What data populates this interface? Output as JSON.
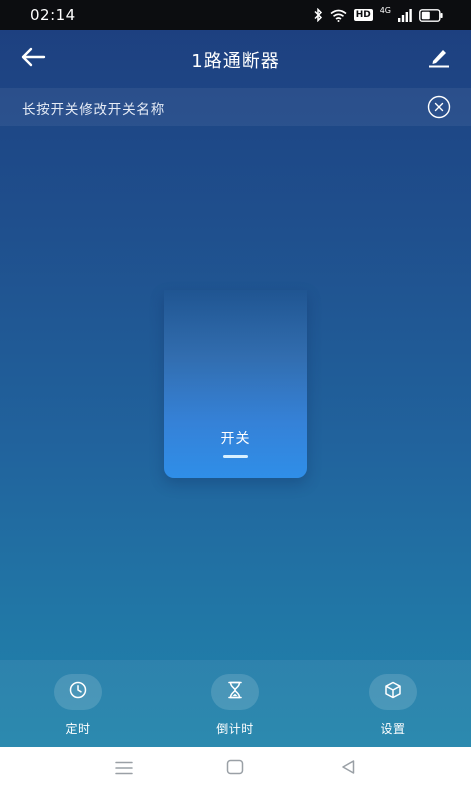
{
  "status_bar": {
    "time": "02:14",
    "hd_badge": "HD",
    "network": "4G",
    "icons": [
      "bluetooth-icon",
      "wifi-icon",
      "hd-icon",
      "signal-icon",
      "battery-icon"
    ]
  },
  "header": {
    "title": "1路通断器",
    "back_icon": "arrow-left-icon",
    "edit_icon": "pencil-icon"
  },
  "hint": {
    "text": "长按开关修改开关名称",
    "close_icon": "circle-x-icon"
  },
  "switch": {
    "label": "开关"
  },
  "toolbar": {
    "items": [
      {
        "label": "定时",
        "icon": "clock-icon"
      },
      {
        "label": "倒计时",
        "icon": "hourglass-icon"
      },
      {
        "label": "设置",
        "icon": "cube-icon"
      }
    ]
  },
  "nav_bar": {
    "icons": [
      "menu-icon",
      "home-square-icon",
      "back-triangle-icon"
    ]
  },
  "colors": {
    "status_bg": "#0c0d10",
    "bg_top": "#1d3e7e",
    "bg_bottom": "#1f83aa",
    "switch_accent": "#2f8ee8",
    "text": "#ffffff"
  }
}
